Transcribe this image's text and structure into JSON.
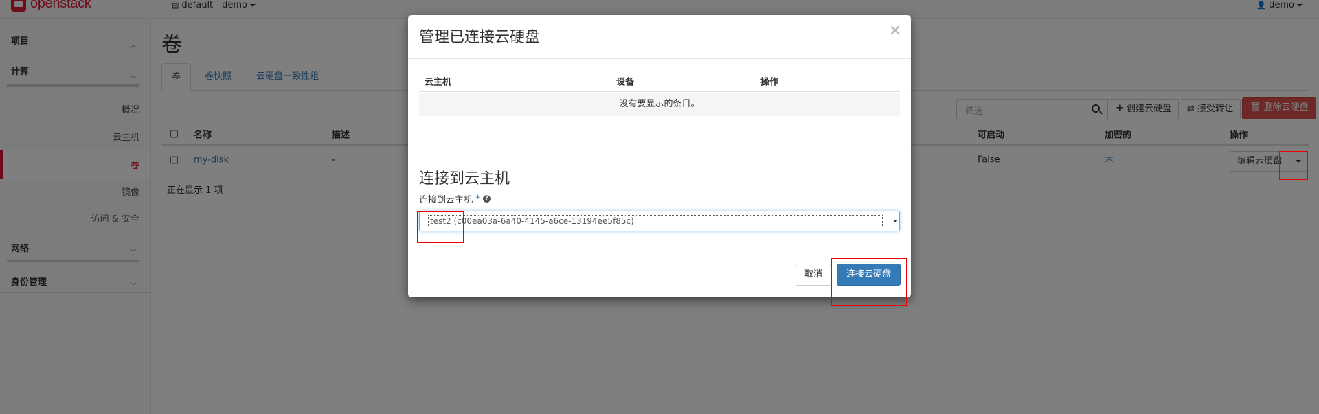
{
  "topbar": {
    "logo_text": "openstack",
    "project": "default - demo",
    "user": "demo"
  },
  "sidebar": {
    "sections": [
      {
        "label": "项目",
        "chevron": "up"
      },
      {
        "label": "计算",
        "chevron": "up"
      },
      {
        "label": "网络",
        "chevron": "down"
      },
      {
        "label": "身份管理",
        "chevron": "down"
      }
    ],
    "compute_items": [
      "概况",
      "云主机",
      "卷",
      "镜像",
      "访问 & 安全"
    ],
    "active_item": "卷"
  },
  "page": {
    "title": "卷",
    "tabs": [
      "卷",
      "卷快照",
      "云硬盘一致性组"
    ],
    "filter_placeholder": "筛选",
    "buttons": {
      "create": "创建云硬盘",
      "accept_transfer": "接受转让",
      "delete": "删除云硬盘"
    },
    "table": {
      "columns": [
        "名称",
        "描述",
        "可启动",
        "加密的",
        "操作"
      ],
      "rows": [
        {
          "name": "my-disk",
          "description": "-",
          "bootable": "False",
          "encrypted": "不",
          "action": "编辑云硬盘"
        }
      ]
    },
    "footer_count": "正在显示 1 项"
  },
  "modal": {
    "title": "管理已连接云硬盘",
    "close": "×",
    "table_columns": [
      "云主机",
      "设备",
      "操作"
    ],
    "empty_text": "没有要显示的条目。",
    "section_title": "连接到云主机",
    "field_label": "连接到云主机",
    "required_mark": "*",
    "selected_instance": "test2 (c00ea03a-6a40-4145-a6ce-13194ee5f85c)",
    "cancel_label": "取消",
    "submit_label": "连接云硬盘"
  },
  "colors": {
    "brand": "#da1a32",
    "primary": "#337ab7",
    "danger": "#d9534f",
    "highlight": "#e00000"
  }
}
